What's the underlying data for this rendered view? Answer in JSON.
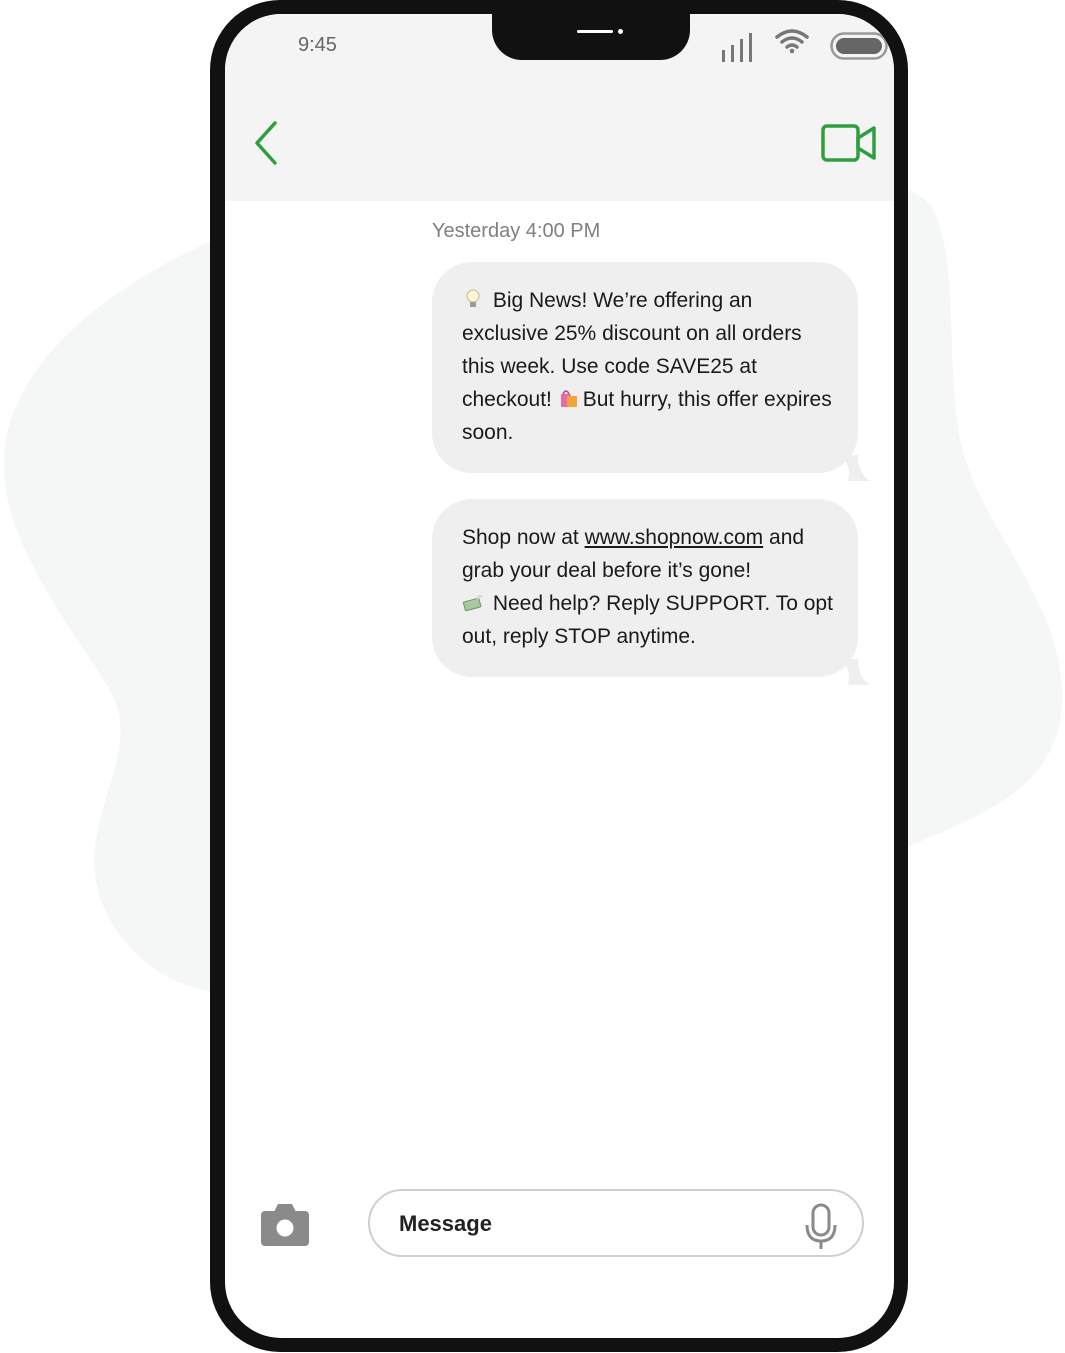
{
  "status_bar": {
    "time": "9:45"
  },
  "header": {
    "back_icon": "chevron-left-icon",
    "video_icon": "video-camera-icon"
  },
  "conversation": {
    "timestamp": "Yesterday 4:00 PM",
    "messages": [
      {
        "emoji_1": "light-bulb",
        "text_1": " Big News! We’re offering an exclusive 25% discount on all orders this week. Use code SAVE25 at checkout! ",
        "emoji_2": "shopping-bags",
        "text_2": "But hurry, this offer expires soon."
      },
      {
        "text_1": "Shop now at ",
        "link": "www.shopnow.com",
        "text_2": " and grab your deal before it’s gone!",
        "emoji_1": "money-with-wings",
        "text_3": " Need help? Reply SUPPORT. To opt out, reply STOP anytime."
      }
    ]
  },
  "composer": {
    "placeholder": "Message",
    "camera_icon": "camera-icon",
    "mic_icon": "microphone-icon"
  },
  "colors": {
    "accent": "#2e9e3e",
    "bubble": "#efefef",
    "phone_frame": "#111111",
    "header_bg": "#f4f4f4"
  }
}
